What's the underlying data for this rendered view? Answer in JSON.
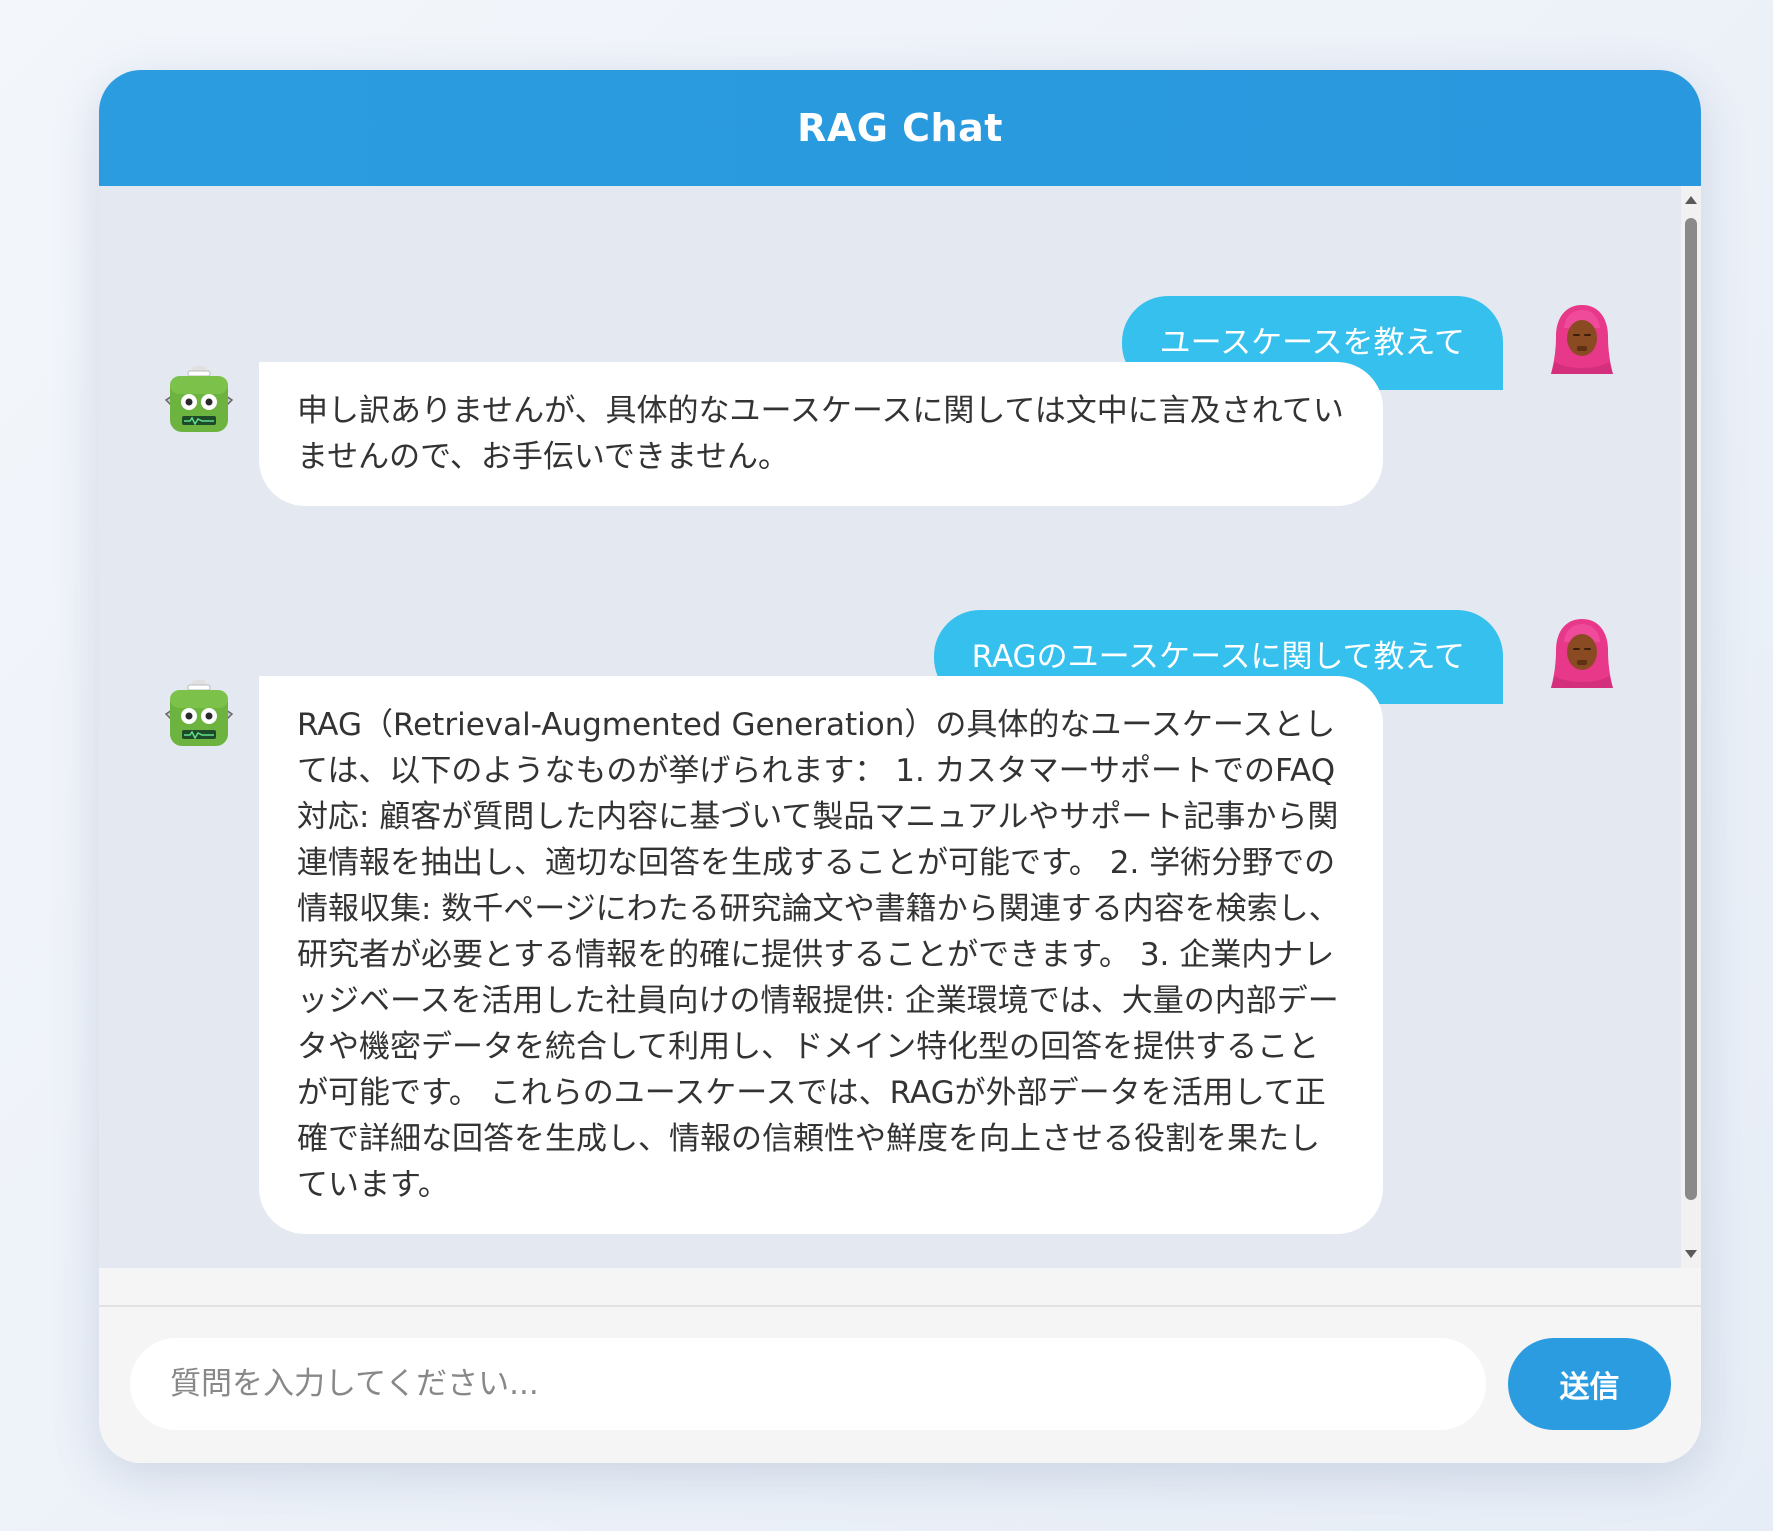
{
  "header": {
    "title": "RAG Chat"
  },
  "messages": [
    {
      "role": "user",
      "avatar": "person-with-headscarf-icon",
      "text": "ユースケースを教えて"
    },
    {
      "role": "bot",
      "avatar": "robot-icon",
      "text": "申し訳ありませんが、具体的なユースケースに関しては文中に言及されていませんので、お手伝いできません。"
    },
    {
      "role": "user",
      "avatar": "person-with-headscarf-icon",
      "text": "RAGのユースケースに関して教えて"
    },
    {
      "role": "bot",
      "avatar": "robot-icon",
      "text": "RAG（Retrieval-Augmented Generation）の具体的なユースケースとしては、以下のようなものが挙げられます： 1. カスタマーサポートでのFAQ対応: 顧客が質問した内容に基づいて製品マニュアルやサポート記事から関連情報を抽出し、適切な回答を生成することが可能です。 2. 学術分野での情報収集: 数千ページにわたる研究論文や書籍から関連する内容を検索し、研究者が必要とする情報を的確に提供することができます。 3. 企業内ナレッジベースを活用した社員向けの情報提供: 企業環境では、大量の内部データや機密データを統合して利用し、ドメイン特化型の回答を提供することが可能です。 これらのユースケースでは、RAGが外部データを活用して正確で詳細な回答を生成し、情報の信頼性や鮮度を向上させる役割を果たしています。"
    }
  ],
  "input": {
    "placeholder": "質問を入力してください...",
    "value": ""
  },
  "send_button": {
    "label": "送信"
  },
  "colors": {
    "header": "#2b9ce0",
    "user_bubble": "#36c0ee",
    "bot_bubble": "#ffffff",
    "messages_bg": "#e4e8f0"
  }
}
